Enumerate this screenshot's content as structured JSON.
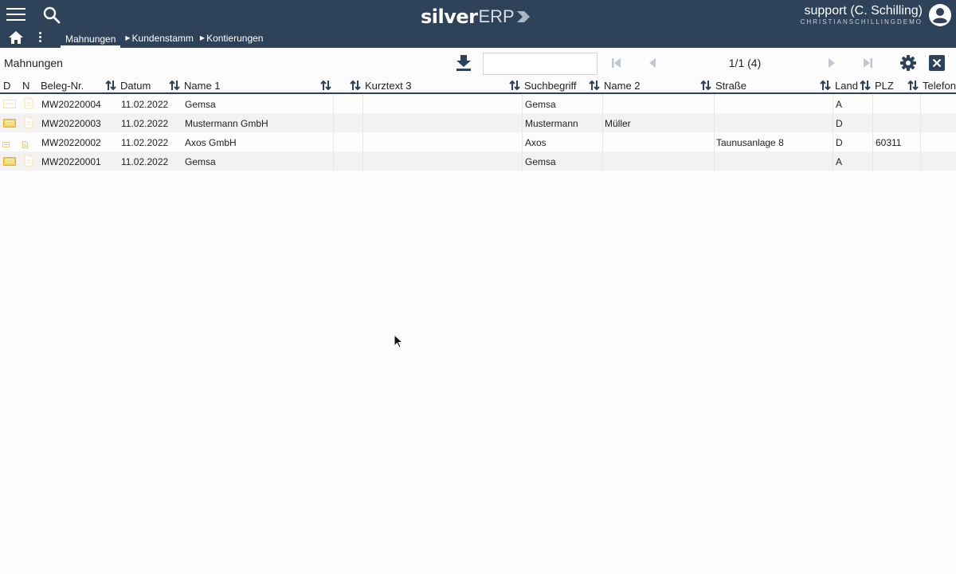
{
  "header": {
    "logo_primary": "silver",
    "logo_secondary": "ERP",
    "user_name": "support (C. Schilling)",
    "user_company": "CHRISTIANSCHILLINGDEMO"
  },
  "tabs": [
    {
      "label": "Mahnungen",
      "active": true
    },
    {
      "label": "Kundenstamm",
      "active": false
    },
    {
      "label": "Kontierungen",
      "active": false
    }
  ],
  "toolbar": {
    "title": "Mahnungen",
    "search_value": "",
    "pager": "1/1 (4)"
  },
  "columns": [
    "D",
    "N",
    "Beleg-Nr.",
    "Datum",
    "Name 1",
    "Kurztext 3",
    "Suchbegriff",
    "Name 2",
    "Straße",
    "Land",
    "PLZ",
    "Telefon"
  ],
  "rows": [
    {
      "beleg": "MW20220004",
      "datum": "11.02.2022",
      "name1": "Gemsa",
      "kurztext3": "",
      "such": "Gemsa",
      "name2": "",
      "strasse": "",
      "land": "A",
      "plz": "",
      "telefon": "",
      "icon_style": "faint"
    },
    {
      "beleg": "MW20220003",
      "datum": "11.02.2022",
      "name1": "Mustermann GmbH",
      "kurztext3": "",
      "such": "Mustermann",
      "name2": "Müller",
      "strasse": "",
      "land": "D",
      "plz": "",
      "telefon": "",
      "icon_style": "strong"
    },
    {
      "beleg": "MW20220002",
      "datum": "11.02.2022",
      "name1": "Axos GmbH",
      "kurztext3": "",
      "such": "Axos",
      "name2": "",
      "strasse": "Taunusanlage 8",
      "land": "D",
      "plz": "60311",
      "telefon": "",
      "icon_style": "small"
    },
    {
      "beleg": "MW20220001",
      "datum": "11.02.2022",
      "name1": "Gemsa",
      "kurztext3": "",
      "such": "Gemsa",
      "name2": "",
      "strasse": "",
      "land": "A",
      "plz": "",
      "telefon": "",
      "icon_style": "strong"
    }
  ],
  "colors": {
    "topbar": "#2e4259",
    "accent_icon": "#f0c419",
    "sort_icon": "#2e4259"
  },
  "icons": [
    "menu-icon",
    "search-icon",
    "user-avatar-icon",
    "home-icon",
    "more-vert-icon",
    "download-icon",
    "first-page-icon",
    "prev-page-icon",
    "next-page-icon",
    "last-page-icon",
    "gear-icon",
    "close-icon",
    "sort-icon",
    "folder-icon",
    "document-icon"
  ]
}
